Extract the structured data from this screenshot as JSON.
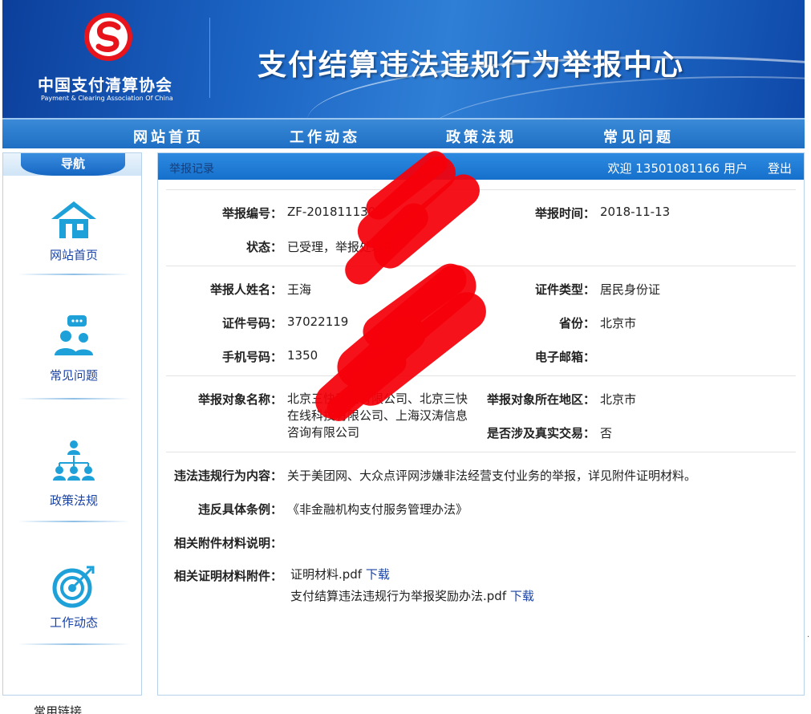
{
  "header": {
    "org_name_cn": "中国支付清算协会",
    "org_name_en": "Payment & Clearing Association Of China",
    "site_title": "支付结算违法违规行为举报中心"
  },
  "nav": {
    "items": [
      {
        "label": "网站首页"
      },
      {
        "label": "工作动态"
      },
      {
        "label": "政策法规"
      },
      {
        "label": "常见问题"
      }
    ]
  },
  "sidebar": {
    "title": "导航",
    "items": [
      {
        "label": "网站首页",
        "icon": "home-icon"
      },
      {
        "label": "常见问题",
        "icon": "faq-people-icon"
      },
      {
        "label": "政策法规",
        "icon": "org-structure-icon"
      },
      {
        "label": "工作动态",
        "icon": "target-icon"
      }
    ]
  },
  "main": {
    "breadcrumb": "举报记录",
    "welcome": "欢迎 13501081166 用户",
    "logout": "登出",
    "report": {
      "id_label": "举报编号：",
      "id_value": "ZF-2018111300",
      "time_label": "举报时间：",
      "time_value": "2018-11-13",
      "status_label": "状态：",
      "status_value": "已受理，举报处理中",
      "name_label": "举报人姓名：",
      "name_value": "王海",
      "id_type_label": "证件类型：",
      "id_type_value": "居民身份证",
      "id_number_label": "证件号码：",
      "id_number_value": "37022119",
      "province_label": "省份：",
      "province_value": "北京市",
      "phone_label": "手机号码：",
      "phone_value": "1350",
      "email_label": "电子邮箱：",
      "email_value": "",
      "target_label": "举报对象名称：",
      "target_value_lines": [
        "北京三快科技有限公司、北京三快",
        "在线科技有限公司、上海汉涛信息",
        "咨询有限公司"
      ],
      "target_region_label": "举报对象所在地区：",
      "target_region_value": "北京市",
      "real_trade_label": "是否涉及真实交易：",
      "real_trade_value": "否",
      "content_label": "违法违规行为内容：",
      "content_value": "关于美团网、大众点评网涉嫌非法经营支付业务的举报，详见附件证明材料。",
      "clause_label": "违反具体条例：",
      "clause_value": "《非金融机构支付服务管理办法》",
      "attach_desc_label": "相关附件材料说明：",
      "attach_desc_value": "",
      "attach_label": "相关证明材料附件：",
      "attachments": [
        {
          "name": "证明材料.pdf",
          "action": "下载"
        },
        {
          "name": "支付结算违法违规行为举报奖励办法.pdf",
          "action": "下载"
        }
      ]
    }
  },
  "footer": {
    "friend_links": "常用链接"
  },
  "colors": {
    "banner_blue": "#1b63c2",
    "nav_blue": "#1e6ec4",
    "link_blue": "#1a43a6",
    "redaction_red": "#f5000a"
  }
}
